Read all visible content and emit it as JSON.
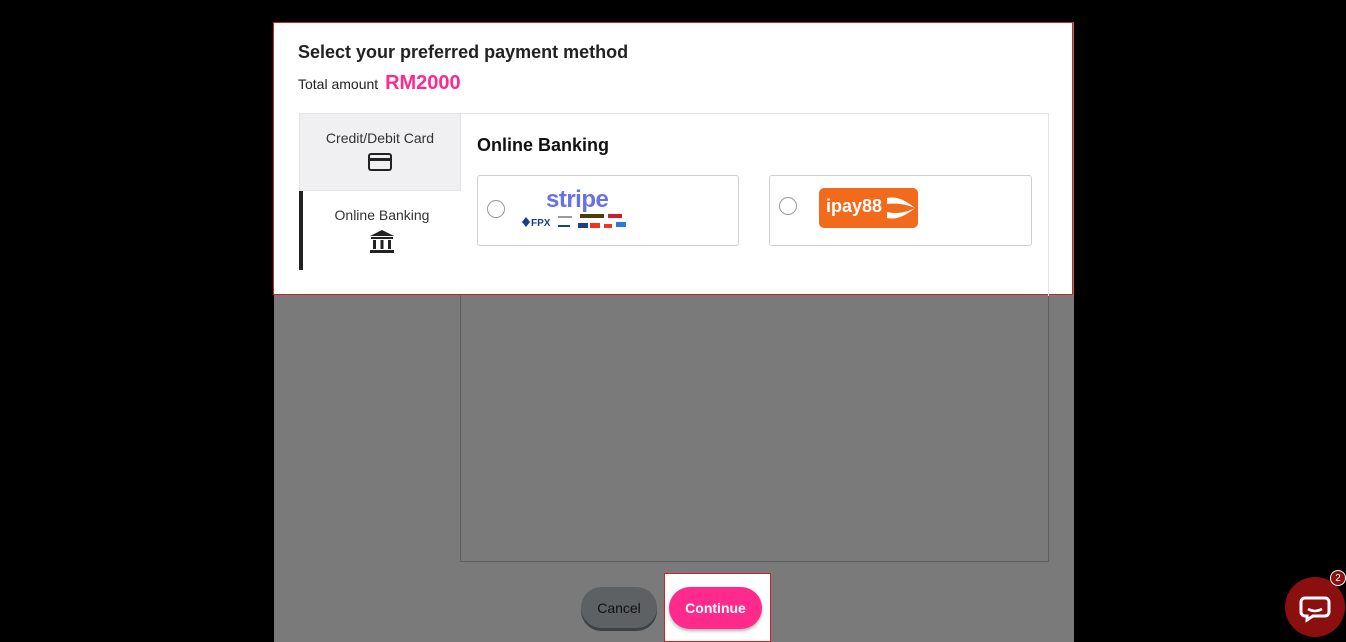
{
  "modal": {
    "title": "Select your preferred payment method",
    "total_label": "Total amount",
    "total_amount": "RM2000"
  },
  "tabs": [
    {
      "label": "Credit/Debit Card",
      "icon": "credit-card-icon"
    },
    {
      "label": "Online Banking",
      "icon": "bank-icon"
    }
  ],
  "panel": {
    "title": "Online Banking",
    "options": [
      {
        "name": "stripe",
        "logo_text": "stripe",
        "sub_text": "FPX"
      },
      {
        "name": "ipay88",
        "logo_text": "ipay88"
      }
    ]
  },
  "buttons": {
    "cancel": "Cancel",
    "continue": "Continue"
  },
  "chat": {
    "badge_count": "2",
    "icon": "chat-icon"
  },
  "colors": {
    "accent": "#ff2a8c",
    "highlight_border": "#d0212b",
    "stripe": "#6772e5",
    "ipay": "#f26a1b"
  }
}
